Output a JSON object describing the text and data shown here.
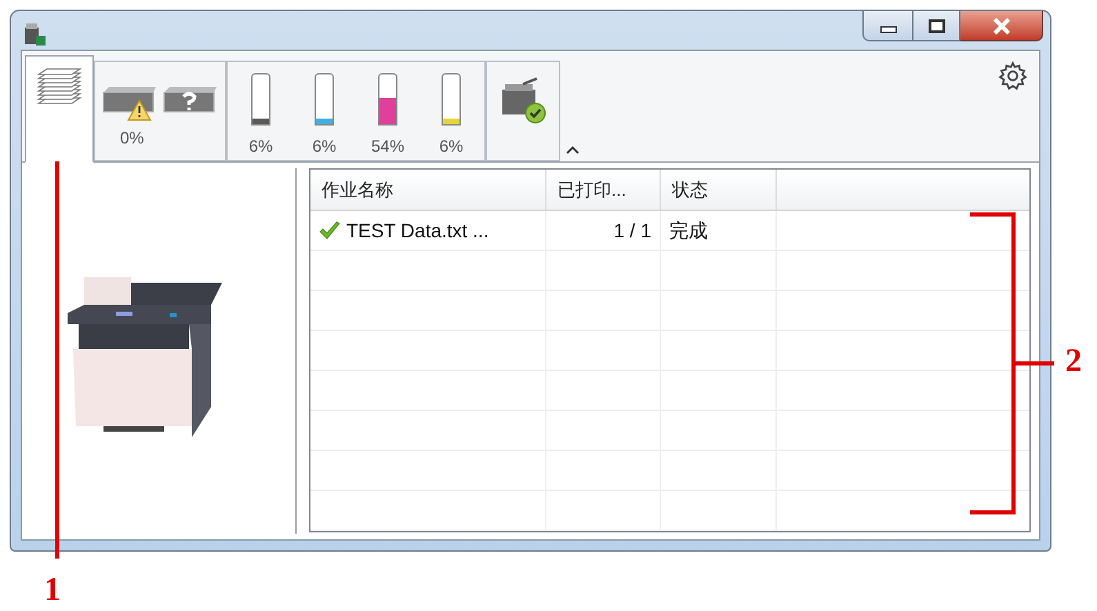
{
  "toolbar": {
    "tabs": [
      {
        "kind": "jobs",
        "selected": true
      },
      {
        "kind": "paper",
        "selected": false,
        "reading": "0%"
      },
      {
        "kind": "toner",
        "selected": false,
        "toners": [
          {
            "color": "#5a5a5a",
            "level": 0.06,
            "reading": "6%"
          },
          {
            "color": "#3fb0e0",
            "level": 0.06,
            "reading": "6%"
          },
          {
            "color": "#e0409c",
            "level": 0.54,
            "reading": "54%"
          },
          {
            "color": "#e6d43c",
            "level": 0.06,
            "reading": "6%"
          }
        ]
      },
      {
        "kind": "device",
        "selected": false
      }
    ]
  },
  "job_table": {
    "columns": [
      "作业名称",
      "已打印...",
      "状态"
    ],
    "rows": [
      {
        "done": true,
        "cells": [
          "TEST Data.txt ...",
          "1 / 1",
          "完成"
        ]
      }
    ]
  },
  "callouts": [
    {
      "label": "1"
    },
    {
      "label": "2"
    }
  ]
}
